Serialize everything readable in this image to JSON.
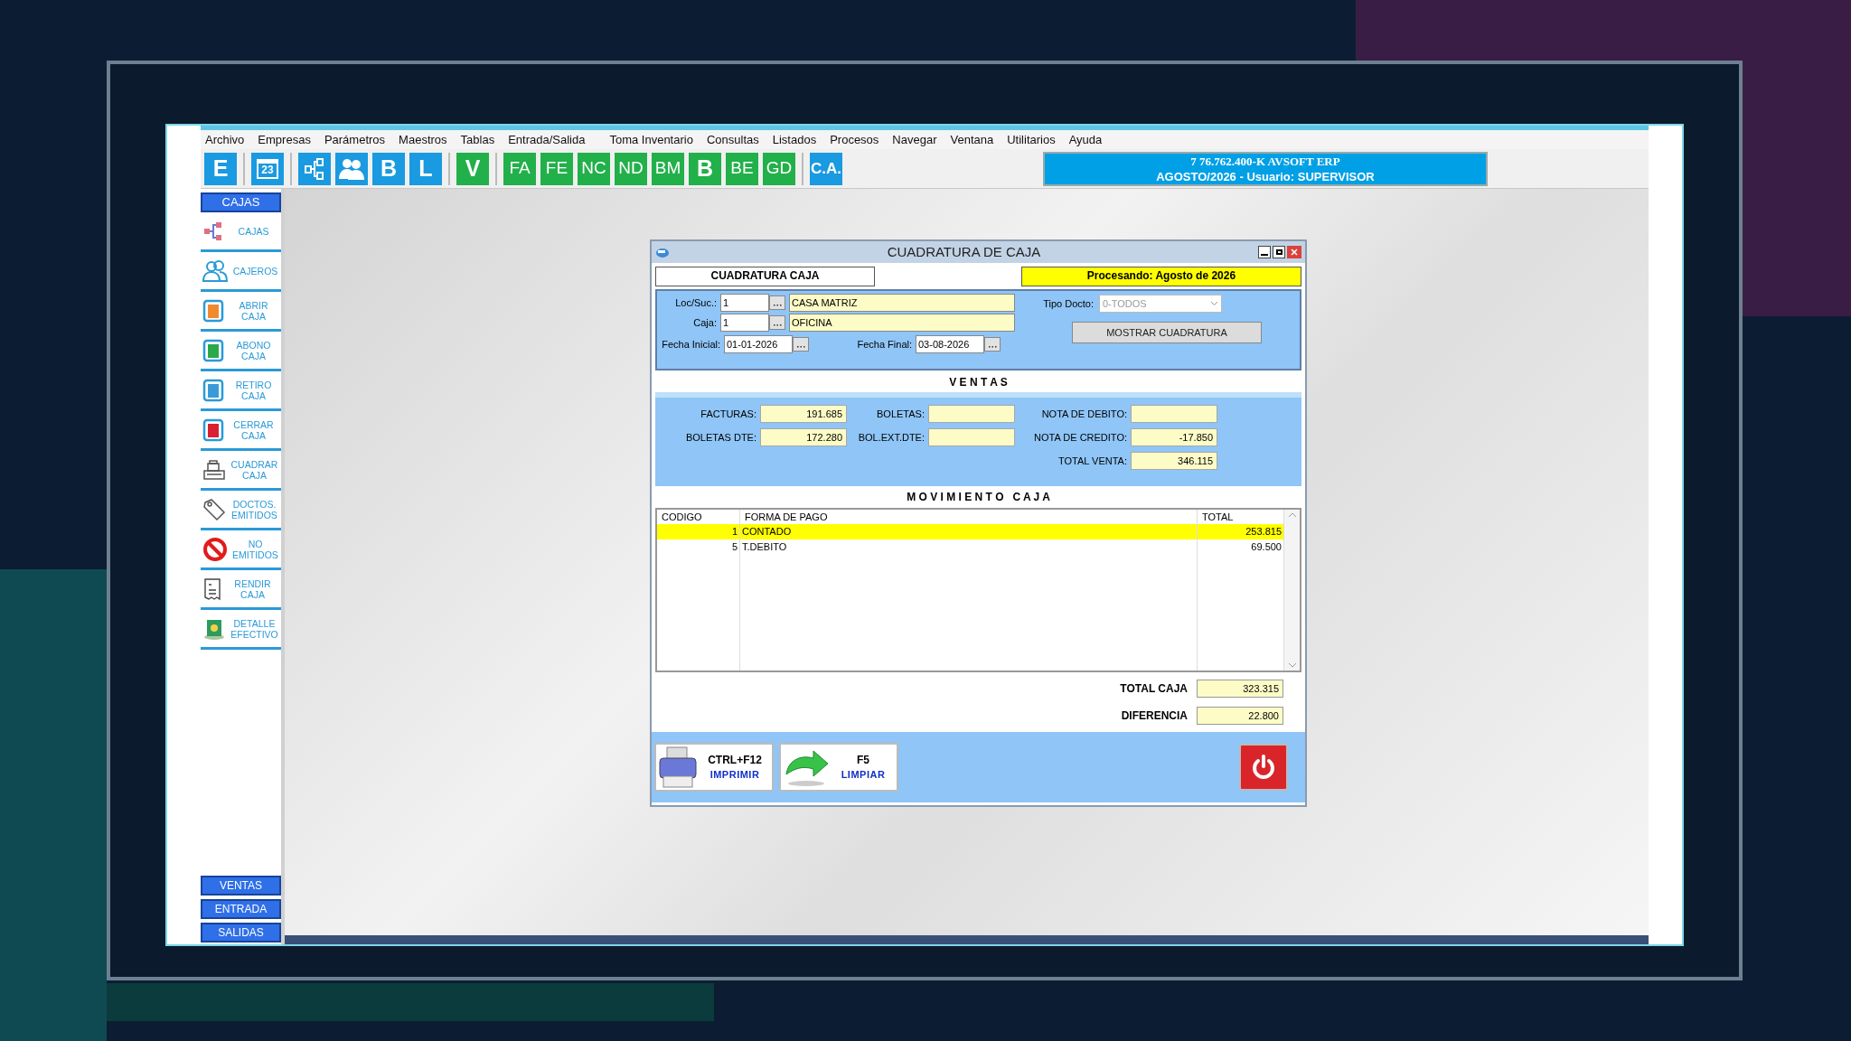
{
  "menu": [
    "Archivo",
    "Empresas",
    "Parámetros",
    "Maestros",
    "Tablas",
    "Entrada/Salida",
    "Toma Inventario",
    "Consultas",
    "Listados",
    "Procesos",
    "Navegar",
    "Ventana",
    "Utilitarios",
    "Ayuda"
  ],
  "toolbar": [
    {
      "kind": "text",
      "label": "E",
      "color": "#1a9ae0",
      "separator_before": false
    },
    {
      "kind": "calendar",
      "label": "23",
      "color": "#1a9ae0",
      "separator_before": true
    },
    {
      "kind": "tree",
      "color": "#1a9ae0",
      "separator_before": true
    },
    {
      "kind": "people",
      "color": "#1a9ae0",
      "separator_before": false
    },
    {
      "kind": "text",
      "label": "B",
      "color": "#1a9ae0",
      "separator_before": false
    },
    {
      "kind": "text",
      "label": "L",
      "color": "#1a9ae0",
      "separator_before": false
    },
    {
      "kind": "text",
      "label": "V",
      "color": "#22b04a",
      "separator_before": true
    },
    {
      "kind": "text",
      "label": "FA",
      "color": "#22b04a",
      "separator_before": true
    },
    {
      "kind": "text",
      "label": "FE",
      "color": "#22b04a",
      "separator_before": false
    },
    {
      "kind": "text",
      "label": "NC",
      "color": "#22b04a",
      "separator_before": false
    },
    {
      "kind": "text",
      "label": "ND",
      "color": "#22b04a",
      "separator_before": false
    },
    {
      "kind": "text",
      "label": "BM",
      "color": "#22b04a",
      "separator_before": false
    },
    {
      "kind": "text",
      "label": "B",
      "color": "#22b04a",
      "separator_before": false
    },
    {
      "kind": "text",
      "label": "BE",
      "color": "#22b04a",
      "separator_before": false
    },
    {
      "kind": "text",
      "label": "GD",
      "color": "#22b04a",
      "separator_before": false
    },
    {
      "kind": "text",
      "label": "C.A.",
      "color": "#1a9ae0",
      "separator_before": true
    }
  ],
  "company_banner": {
    "line_1": "7  76.762.400-K  AVSOFT ERP",
    "line_2": "AGOSTO/2026  -  Usuario: SUPERVISOR"
  },
  "sidebar": {
    "header": "CAJAS",
    "items": [
      {
        "kind": "network",
        "label": "CAJAS"
      },
      {
        "kind": "people",
        "label": "CAJEROS"
      },
      {
        "kind": "document",
        "color": "#f08a30",
        "label": "ABRIR\nCAJA"
      },
      {
        "kind": "document",
        "color": "#2aa84a",
        "label": "ABONO\nCAJA"
      },
      {
        "kind": "document",
        "color": "#3a9ad8",
        "label": "RETIRO\nCAJA"
      },
      {
        "kind": "document",
        "color": "#d82030",
        "label": "CERRAR\nCAJA"
      },
      {
        "kind": "register",
        "label": "CUADRAR\nCAJA"
      },
      {
        "kind": "tag",
        "label": "DOCTOS.\nEMITIDOS"
      },
      {
        "kind": "forbidden",
        "label": "NO\nEMITIDOS"
      },
      {
        "kind": "receipt",
        "label": "RENDIR\nCAJA"
      },
      {
        "kind": "money",
        "label": "DETALLE\nEFECTIVO"
      }
    ],
    "footer_buttons": [
      "VENTAS",
      "ENTRADA",
      "SALIDAS"
    ]
  },
  "dialog": {
    "title": "CUADRATURA DE CAJA",
    "heading": "CUADRATURA CAJA",
    "processing": "Procesando: Agosto de 2026",
    "filters": {
      "loc_label": "Loc/Suc.:",
      "loc_value": "1",
      "loc_name": "CASA MATRIZ",
      "caja_label": "Caja:",
      "caja_value": "1",
      "caja_name": "OFICINA",
      "tipo_label": "Tipo Docto:",
      "tipo_value": "0-TODOS",
      "fecha_inicial_label": "Fecha Inicial:",
      "fecha_inicial": "01-01-2026",
      "fecha_final_label": "Fecha Final:",
      "fecha_final": "03-08-2026",
      "show_button": "MOSTRAR CUADRATURA"
    },
    "ventas_title": "V E N T A S",
    "ventas": [
      {
        "label": "FACTURAS:",
        "value": "191.685"
      },
      {
        "label": "BOLETAS:"
      },
      {
        "label": "NOTA DE DEBITO:"
      },
      {
        "label": "BOLETAS DTE:",
        "value": "172.280"
      },
      {
        "label": "BOL.EXT.DTE:"
      },
      {
        "label": "NOTA DE CREDITO:",
        "value": "-17.850"
      },
      {
        "label": "TOTAL VENTA:",
        "value": "346.115"
      }
    ],
    "movimiento_title": "M O V I M I E N T O   C A J A",
    "table": {
      "columns": [
        "CODIGO",
        "FORMA DE PAGO",
        "TOTAL"
      ],
      "rows": [
        {
          "cells": [
            "1",
            "CONTADO",
            "253.815"
          ],
          "selected": true
        },
        {
          "cells": [
            "5",
            "T.DEBITO",
            "69.500"
          ],
          "selected": false
        }
      ]
    },
    "totals": [
      {
        "label": "TOTAL CAJA",
        "value": "323.315"
      },
      {
        "label": "DIFERENCIA",
        "value": "22.800"
      }
    ],
    "buttons": [
      {
        "kind": "print",
        "key": "CTRL+F12",
        "label": "IMPRIMIR"
      },
      {
        "kind": "clear",
        "key": "F5",
        "label": "LIMPIAR"
      },
      {
        "kind": "power"
      }
    ]
  }
}
